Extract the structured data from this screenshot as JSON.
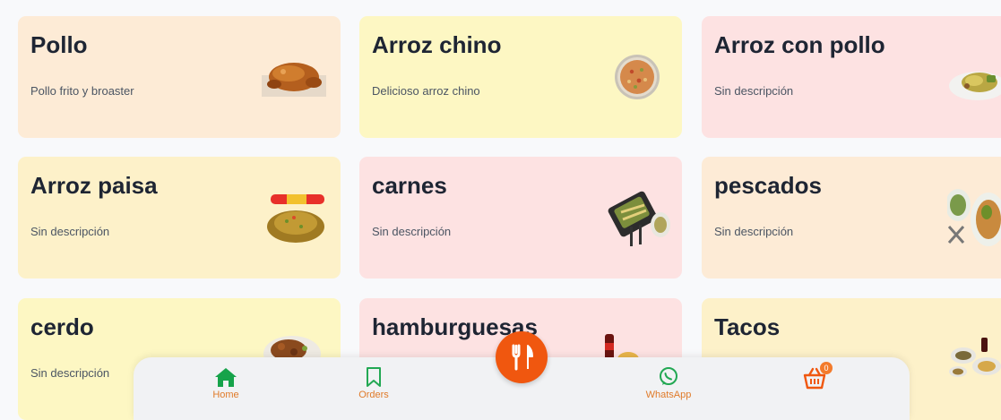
{
  "categories": [
    {
      "title": "Pollo",
      "description": "Pollo frito y broaster",
      "bg": "#fdebd6",
      "image": "fried-chicken-image"
    },
    {
      "title": "Arroz chino",
      "description": "Delicioso arroz chino",
      "bg": "#fdf7c3",
      "image": "fried-rice-plate-image"
    },
    {
      "title": "Arroz con pollo",
      "description": "Sin descripción",
      "bg": "#fde2e2",
      "image": "rice-chicken-plate-image"
    },
    {
      "title": "Arroz paisa",
      "description": "Sin descripción",
      "bg": "#fdf1c9",
      "image": "arroz-paisa-image"
    },
    {
      "title": "carnes",
      "description": "Sin descripción",
      "bg": "#fde2e2",
      "image": "meat-board-image"
    },
    {
      "title": "pescados",
      "description": "Sin descripción",
      "bg": "#fdebd6",
      "image": "fish-plate-image"
    },
    {
      "title": "cerdo",
      "description": "Sin descripción",
      "bg": "#fdf7c3",
      "image": "pork-plate-image"
    },
    {
      "title": "hamburguesas",
      "description": "",
      "bg": "#fde2e2",
      "image": "burger-soda-image"
    },
    {
      "title": "Tacos",
      "description": "",
      "bg": "#fdf1c9",
      "image": "tacos-plate-image"
    }
  ],
  "nav": {
    "home": "Home",
    "orders": "Orders",
    "whatsapp": "WhatsApp",
    "cart_count": "0"
  },
  "colors": {
    "accent": "#f0570f",
    "nav_label": "#e07b2a",
    "home_icon": "#16a34a",
    "icon_green": "#22a853"
  }
}
